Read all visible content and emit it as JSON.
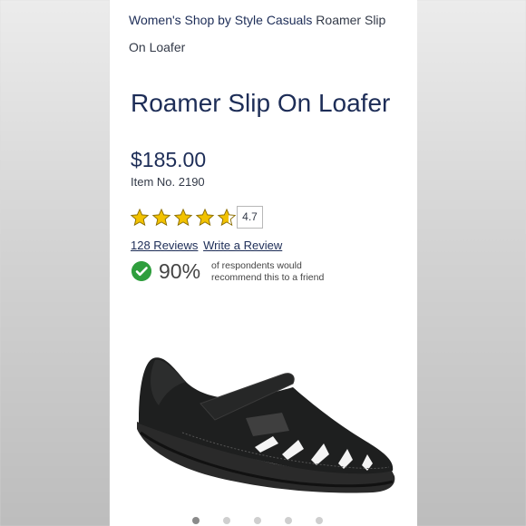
{
  "breadcrumb": {
    "shop_link": "Women's Shop by Style Casuals",
    "current": "Roamer Slip On Loafer"
  },
  "product": {
    "title": "Roamer Slip On Loafer",
    "price": "$185.00",
    "item_no": "Item No. 2190",
    "rating_value": "4.7",
    "stars": 4.7,
    "reviews_link": "128 Reviews",
    "write_review_link": "Write a Review",
    "recommend_percent": "90%",
    "recommend_text": "of respondents would recommend this to a friend"
  },
  "gallery": {
    "slide_count": 5,
    "active_index": 0
  },
  "colors": {
    "navy": "#1d2d57",
    "star": "#f2c200",
    "check_green": "#2f9e3d"
  }
}
